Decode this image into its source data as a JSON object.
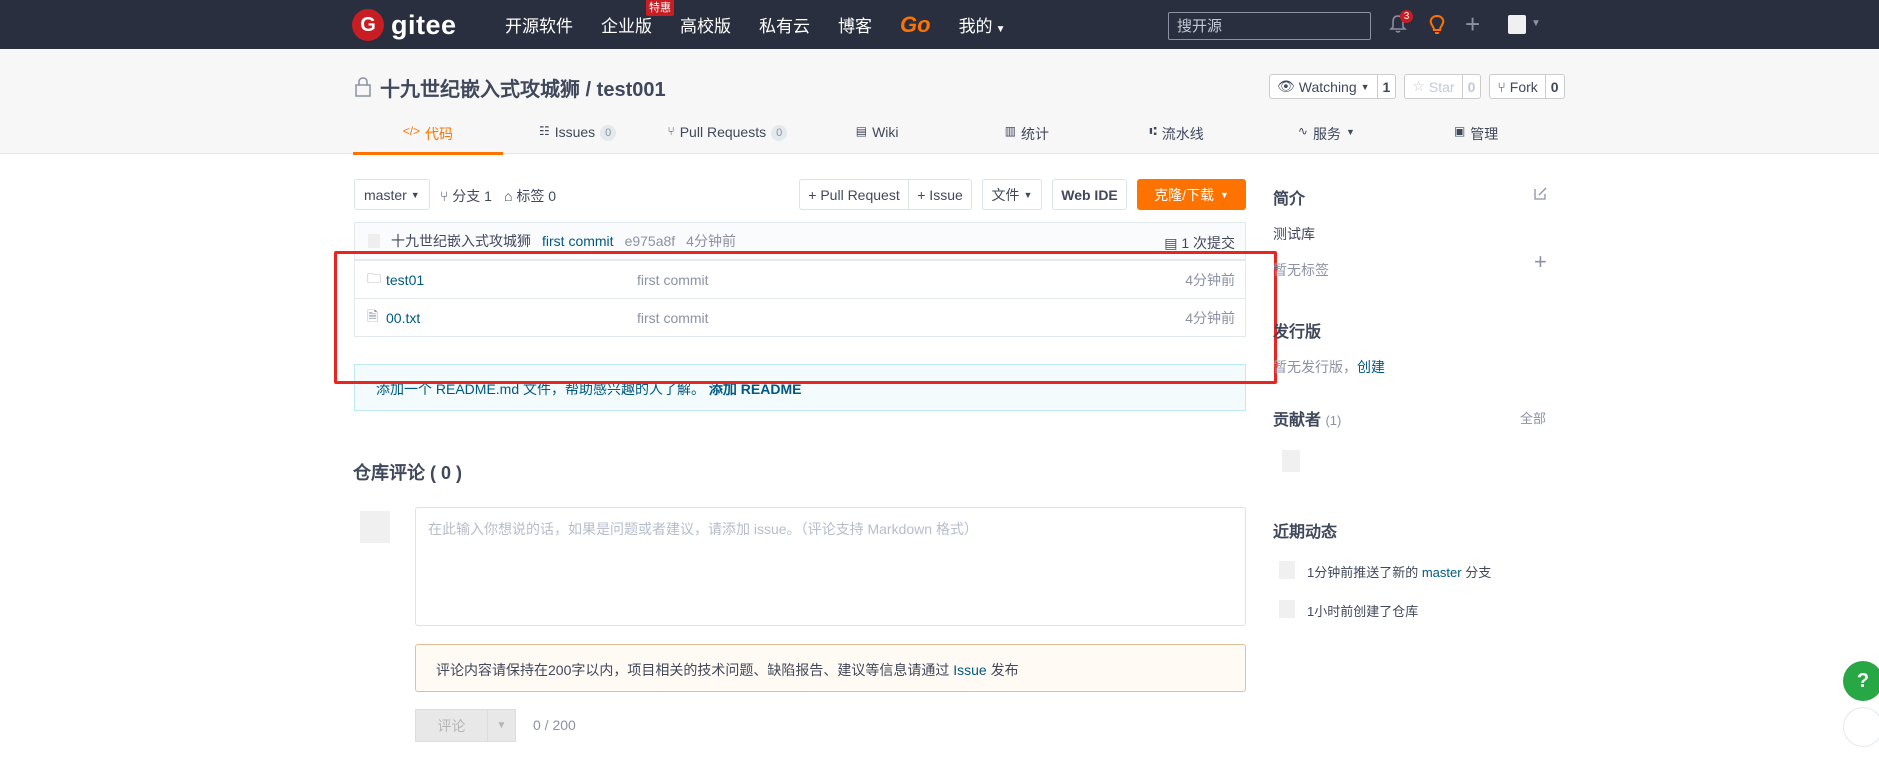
{
  "topbar": {
    "logo_text": "gitee",
    "nav": [
      "开源软件",
      "企业版",
      "高校版",
      "私有云",
      "博客",
      "Go",
      "我的"
    ],
    "enterprise_badge": "特惠",
    "search_placeholder": "搜开源",
    "notification_count": "3"
  },
  "repo": {
    "path": "十九世纪嵌入式攻城狮 / test001",
    "watching_label": "Watching",
    "watching_count": "1",
    "star_label": "Star",
    "star_count": "0",
    "fork_label": "Fork",
    "fork_count": "0"
  },
  "tabs": [
    {
      "label": "代码",
      "icon": "</>",
      "active": true
    },
    {
      "label": "Issues",
      "count": "0",
      "icon": "issues-icon"
    },
    {
      "label": "Pull Requests",
      "count": "0",
      "icon": "pr-icon"
    },
    {
      "label": "Wiki",
      "icon": "wiki-icon"
    },
    {
      "label": "统计",
      "icon": "stats-icon"
    },
    {
      "label": "流水线",
      "icon": "pipeline-icon"
    },
    {
      "label": "服务",
      "icon": "service-icon"
    },
    {
      "label": "管理",
      "icon": "manage-icon"
    }
  ],
  "toolbar": {
    "branch": "master",
    "branches_label": "分支 1",
    "tags_label": "标签 0",
    "pull_request": "+ Pull Request",
    "issue": "+ Issue",
    "file": "文件",
    "web_ide": "Web IDE",
    "clone": "克隆/下载"
  },
  "commit": {
    "author": "十九世纪嵌入式攻城狮",
    "message": "first commit",
    "hash": "e975a8f",
    "time": "4分钟前",
    "count": "1 次提交"
  },
  "files": [
    {
      "name": "test01",
      "type": "folder",
      "message": "first commit",
      "time": "4分钟前"
    },
    {
      "name": "00.txt",
      "type": "file",
      "message": "first commit",
      "time": "4分钟前"
    }
  ],
  "readme": {
    "text": "添加一个 README.md 文件，帮助感兴趣的人了解。",
    "link": "添加 README"
  },
  "comments": {
    "title": "仓库评论 ( 0 )",
    "placeholder": "在此输入你想说的话，如果是问题或者建议，请添加 issue。（评论支持 Markdown 格式）",
    "notice_before": "评论内容请保持在200字以内，项目相关的技术问题、缺陷报告、建议等信息请通过 ",
    "notice_link": "Issue",
    "notice_after": " 发布",
    "submit": "评论",
    "char_count": "0 / 200"
  },
  "sidebar": {
    "intro_title": "简介",
    "description": "测试库",
    "no_tags": "暂无标签",
    "releases_title": "发行版",
    "no_releases": "暂无发行版，",
    "create_link": "创建",
    "contributors_title": "贡献者",
    "contributors_count": "(1)",
    "all_label": "全部",
    "activity_title": "近期动态",
    "activities": [
      {
        "before": "1分钟前推送了新的 ",
        "link": "master",
        "after": " 分支"
      },
      {
        "before": "1小时前创建了仓库",
        "link": "",
        "after": ""
      }
    ]
  },
  "help": "?"
}
